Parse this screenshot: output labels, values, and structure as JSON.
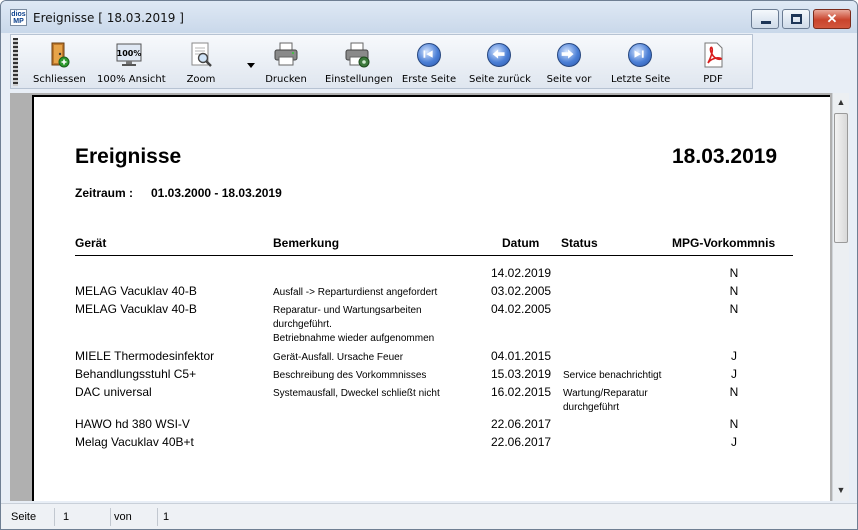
{
  "window": {
    "title": "Ereignisse [ 18.03.2019 ]",
    "app_icon_text": [
      "dios",
      "MP"
    ],
    "close_glyph": "✕"
  },
  "toolbar": {
    "items": [
      {
        "label": "Schliessen",
        "icon": "door-exit-icon"
      },
      {
        "label": "100% Ansicht",
        "icon": "zoom-100-icon"
      },
      {
        "label": "Zoom",
        "icon": "zoom-icon"
      },
      {
        "label": "Drucken",
        "icon": "printer-icon"
      },
      {
        "label": "Einstellungen",
        "icon": "printer-settings-icon"
      },
      {
        "label": "Erste Seite",
        "icon": "first-page-icon"
      },
      {
        "label": "Seite zurück",
        "icon": "previous-page-icon"
      },
      {
        "label": "Seite vor",
        "icon": "next-page-icon"
      },
      {
        "label": "Letzte Seite",
        "icon": "last-page-icon"
      },
      {
        "label": "PDF",
        "icon": "pdf-icon"
      }
    ],
    "zoom_100_text": "100%"
  },
  "report": {
    "title": "Ereignisse",
    "date": "18.03.2019",
    "range_label": "Zeitraum :",
    "range": "01.03.2000 - 18.03.2019",
    "headers": {
      "device": "Gerät",
      "remark": "Bemerkung",
      "date": "Datum",
      "status": "Status",
      "mpg": "MPG-Vorkommnis"
    },
    "rows": [
      {
        "device": "",
        "remark": [],
        "date": "14.02.2019",
        "status": [],
        "mpg": "N"
      },
      {
        "device": "MELAG Vacuklav 40-B",
        "remark": [
          "Ausfall -> Reparturdienst angefordert"
        ],
        "date": "03.02.2005",
        "status": [],
        "mpg": "N"
      },
      {
        "device": "MELAG Vacuklav 40-B",
        "remark": [
          "Reparatur- und Wartungsarbeiten",
          "durchgeführt.",
          "Betriebnahme wieder aufgenommen"
        ],
        "date": "04.02.2005",
        "status": [],
        "mpg": "N"
      },
      {
        "device": "MIELE Thermodesinfektor",
        "remark": [
          "Gerät-Ausfall. Ursache Feuer"
        ],
        "date": "04.01.2015",
        "status": [],
        "mpg": "J"
      },
      {
        "device": "Behandlungsstuhl C5+",
        "remark": [
          "Beschreibung des Vorkommnisses"
        ],
        "date": "15.03.2019",
        "status": [
          "Service benachrichtigt"
        ],
        "mpg": "J"
      },
      {
        "device": "DAC universal",
        "remark": [
          "Systemausfall, Dweckel schließt nicht"
        ],
        "date": "16.02.2015",
        "status": [
          "Wartung/Reparatur",
          "durchgeführt"
        ],
        "mpg": "N"
      },
      {
        "device": "HAWO hd 380 WSI-V",
        "remark": [],
        "date": "22.06.2017",
        "status": [],
        "mpg": "N"
      },
      {
        "device": "Melag Vacuklav 40B+t",
        "remark": [],
        "date": "22.06.2017",
        "status": [],
        "mpg": "J"
      }
    ]
  },
  "scrollbar": {
    "up": "▲",
    "down": "▼"
  },
  "statusbar": {
    "page_label": "Seite",
    "page": "1",
    "of_label": "von",
    "total": "1"
  }
}
